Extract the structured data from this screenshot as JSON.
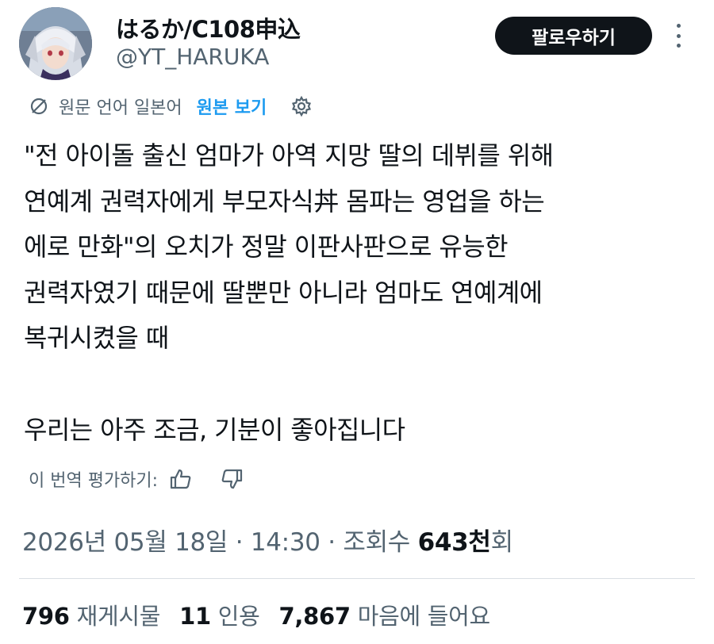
{
  "author": {
    "display_name": "はるか/C108申込",
    "handle": "@YT_HARUKA",
    "avatar_icon": "anime-avatar"
  },
  "follow_label": "팔로우하기",
  "more_icon": "more-vertical-icon",
  "translation": {
    "original_language": "원문 언어 일본어",
    "show_original": "원본 보기"
  },
  "body_lines": [
    "\"전 아이돌 출신 엄마가 아역 지망 딸의 데뷔를 위해",
    "연예계 권력자에게 부모자식丼 몸파는 영업을 하는",
    "에로 만화\"의 오치가 정말 이판사판으로 유능한",
    "권력자였기 때문에 딸뿐만 아니라 엄마도 연예계에",
    "복귀시켰을 때",
    "우리는 아주 조금, 기분이 좋아집니다"
  ],
  "rate_label": "이 번역 평가하기:",
  "meta": {
    "date": "2026년 05월 18일",
    "time": "14:30",
    "views_label_prefix": "조회수",
    "views_value": "643천",
    "views_suffix": "회"
  },
  "stats": {
    "reposts": "796",
    "reposts_label": "재게시물",
    "quotes": "11",
    "quotes_label": "인용",
    "likes": "7,867",
    "likes_label": "마음에 들어요"
  },
  "colors": {
    "text": "#0f1419",
    "secondary": "#536471",
    "link": "#1d9bf0",
    "button_bg": "#0f1419"
  }
}
